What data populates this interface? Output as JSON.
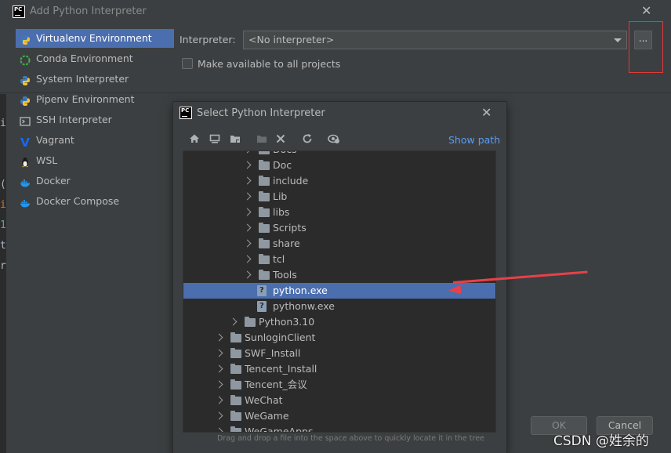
{
  "outer_dialog": {
    "title": "Add Python Interpreter",
    "logo_text": "PC",
    "nav_items": [
      {
        "label": "Virtualenv Environment",
        "icon": "python-icon"
      },
      {
        "label": "Conda Environment",
        "icon": "conda-icon"
      },
      {
        "label": "System Interpreter",
        "icon": "python-icon"
      },
      {
        "label": "Pipenv Environment",
        "icon": "python-icon"
      },
      {
        "label": "SSH Interpreter",
        "icon": "terminal-icon"
      },
      {
        "label": "Vagrant",
        "icon": "vagrant-icon"
      },
      {
        "label": "WSL",
        "icon": "linux-icon"
      },
      {
        "label": "Docker",
        "icon": "docker-icon"
      },
      {
        "label": "Docker Compose",
        "icon": "docker-icon"
      }
    ],
    "interpreter_label": "Interpreter:",
    "interpreter_value": "<No interpreter>",
    "browse_label": "...",
    "make_available_label": "Make available to all projects",
    "ok_label": "OK",
    "cancel_label": "Cancel"
  },
  "background_code_chars": [
    "i",
    "(",
    "i",
    "1",
    "t",
    "r"
  ],
  "inner_dialog": {
    "title": "Select Python Interpreter",
    "logo_text": "PC",
    "show_path_label": "Show path",
    "toolbar_icons": [
      "home-icon",
      "desktop-icon",
      "project-folder-icon",
      "new-folder-icon",
      "delete-icon",
      "refresh-icon",
      "show-hidden-icon"
    ],
    "tree_rows": [
      {
        "label": "Docs",
        "type": "folder",
        "level": 2,
        "expandable": true,
        "selected": false
      },
      {
        "label": "Doc",
        "type": "folder",
        "level": 2,
        "expandable": true,
        "selected": false
      },
      {
        "label": "include",
        "type": "folder",
        "level": 2,
        "expandable": true,
        "selected": false
      },
      {
        "label": "Lib",
        "type": "folder",
        "level": 2,
        "expandable": true,
        "selected": false
      },
      {
        "label": "libs",
        "type": "folder",
        "level": 2,
        "expandable": true,
        "selected": false
      },
      {
        "label": "Scripts",
        "type": "folder",
        "level": 2,
        "expandable": true,
        "selected": false
      },
      {
        "label": "share",
        "type": "folder",
        "level": 2,
        "expandable": true,
        "selected": false
      },
      {
        "label": "tcl",
        "type": "folder",
        "level": 2,
        "expandable": true,
        "selected": false
      },
      {
        "label": "Tools",
        "type": "folder",
        "level": 2,
        "expandable": true,
        "selected": false
      },
      {
        "label": "python.exe",
        "type": "exe",
        "level": 2,
        "expandable": false,
        "selected": true
      },
      {
        "label": "pythonw.exe",
        "type": "exe",
        "level": 2,
        "expandable": false,
        "selected": false
      },
      {
        "label": "Python3.10",
        "type": "folder",
        "level": 1,
        "expandable": true,
        "selected": false
      },
      {
        "label": "SunloginClient",
        "type": "folder",
        "level": 0,
        "expandable": true,
        "selected": false
      },
      {
        "label": "SWF_Install",
        "type": "folder",
        "level": 0,
        "expandable": true,
        "selected": false
      },
      {
        "label": "Tencent_Install",
        "type": "folder",
        "level": 0,
        "expandable": true,
        "selected": false
      },
      {
        "label": "Tencent_会议",
        "type": "folder",
        "level": 0,
        "expandable": true,
        "selected": false
      },
      {
        "label": "WeChat",
        "type": "folder",
        "level": 0,
        "expandable": true,
        "selected": false
      },
      {
        "label": "WeGame",
        "type": "folder",
        "level": 0,
        "expandable": true,
        "selected": false
      },
      {
        "label": "WeGameApps",
        "type": "folder",
        "level": 0,
        "expandable": true,
        "selected": false
      }
    ],
    "drop_hint": "Drag and drop a file into the space above to quickly locate it in the tree"
  },
  "annotation_colors": {
    "red_box": "#e0393a",
    "arrow": "#e8404a"
  },
  "accent_color": "#4b6eaf",
  "watermark": "CSDN @姓余的"
}
